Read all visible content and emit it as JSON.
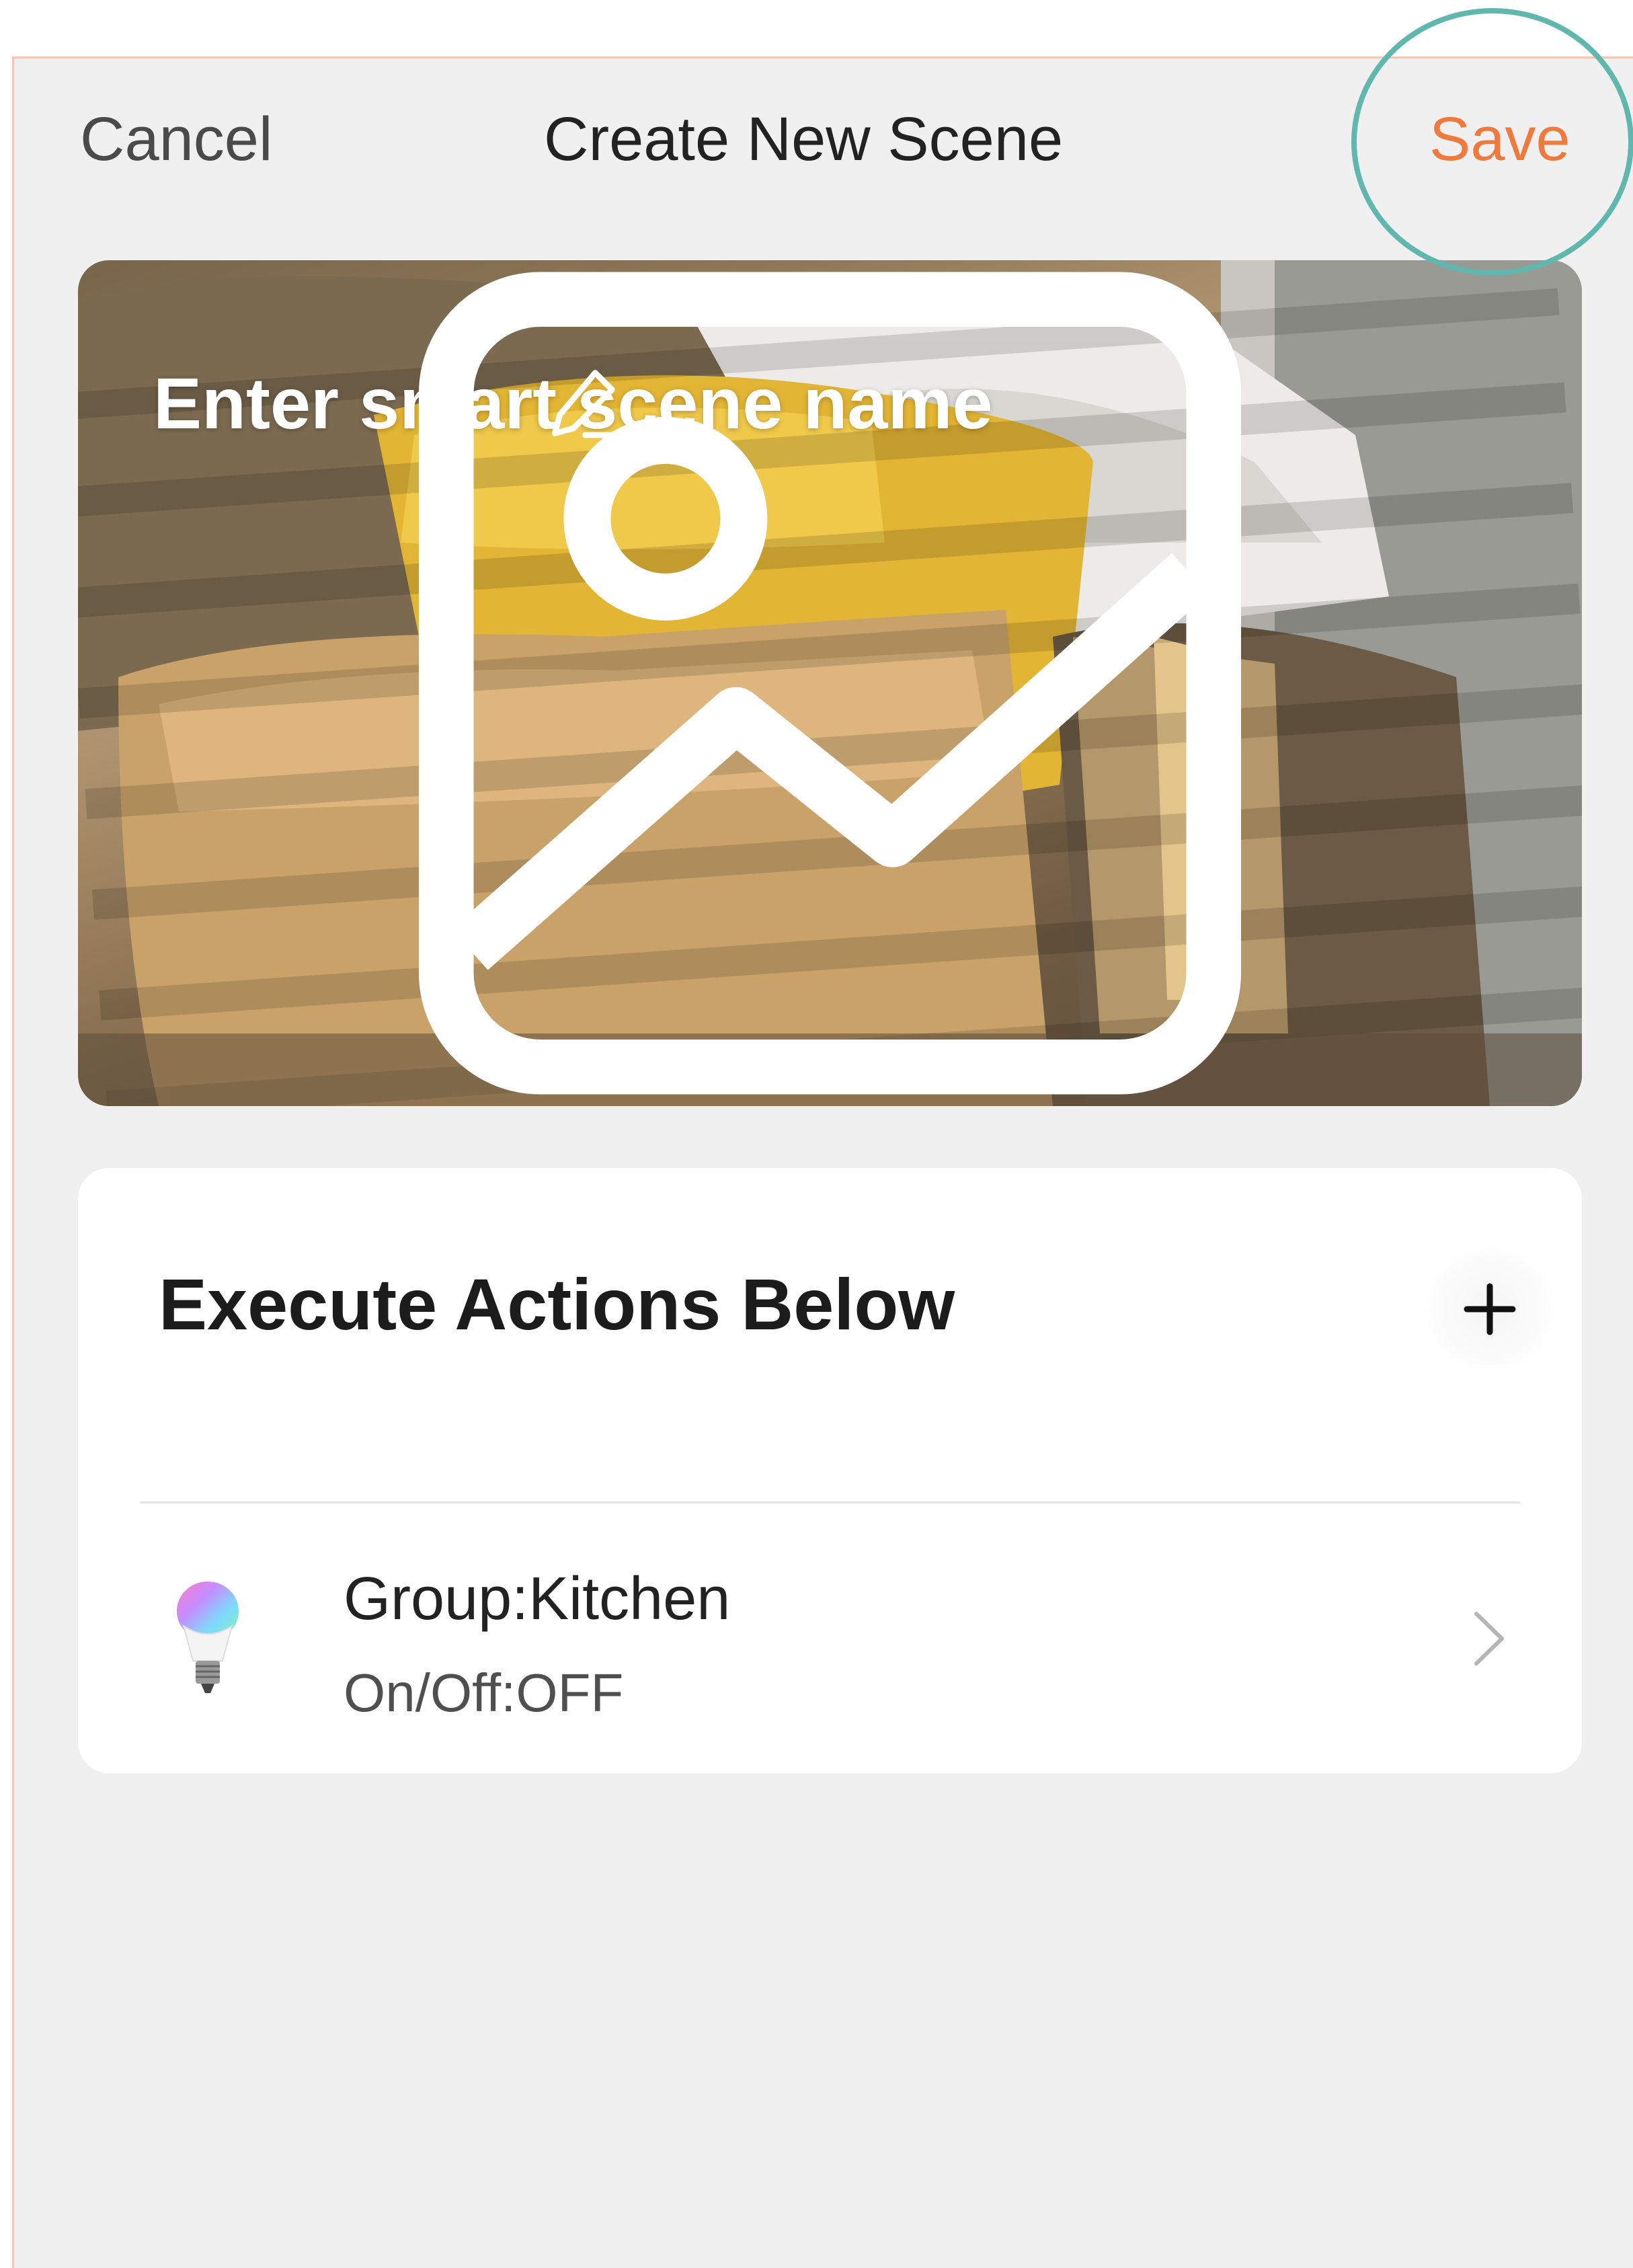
{
  "nav": {
    "cancel_label": "Cancel",
    "title": "Create New Scene",
    "save_label": "Save"
  },
  "cover": {
    "scene_name_placeholder": "Enter smart scene name",
    "edit_icon": "pencil-icon",
    "change_image_icon": "image-icon"
  },
  "actions": {
    "header": "Execute Actions Below",
    "add_icon": "plus-icon",
    "items": [
      {
        "icon": "color-bulb-icon",
        "title": "Group:Kitchen",
        "subtitle": "On/Off:OFF",
        "chevron_icon": "chevron-right-icon"
      }
    ]
  },
  "colors": {
    "accent": "#f07a3e",
    "highlight_ring": "#5fb7ad",
    "background": "#f0f0f0"
  }
}
